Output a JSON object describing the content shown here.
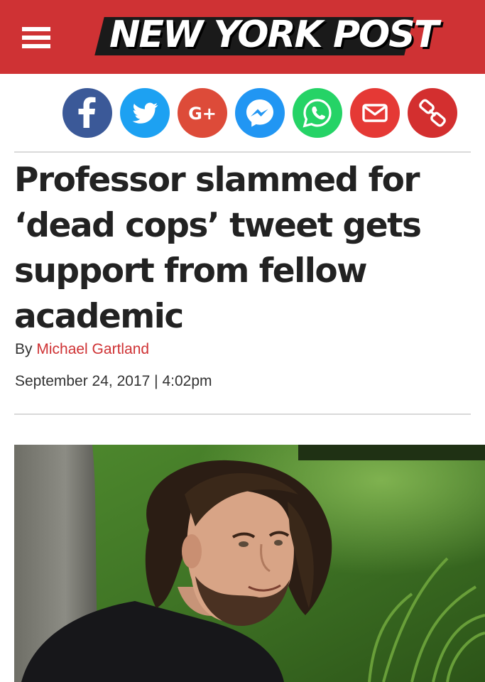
{
  "header": {
    "logo_text": "NEW YORK POST",
    "menu_icon": "hamburger-menu-icon",
    "bg_color": "#cf3234"
  },
  "share": [
    {
      "name": "facebook",
      "icon": "facebook-icon",
      "color": "#3b5998"
    },
    {
      "name": "twitter",
      "icon": "twitter-icon",
      "color": "#1da1f2"
    },
    {
      "name": "google-plus",
      "icon": "google-plus-icon",
      "color": "#dd4b39"
    },
    {
      "name": "messenger",
      "icon": "messenger-icon",
      "color": "#2196f3"
    },
    {
      "name": "whatsapp",
      "icon": "whatsapp-icon",
      "color": "#25d366"
    },
    {
      "name": "email",
      "icon": "email-icon",
      "color": "#e53935"
    },
    {
      "name": "copy-link",
      "icon": "link-icon",
      "color": "#d32f2f"
    }
  ],
  "share_labels": {
    "google_plus": "G+"
  },
  "article": {
    "headline": "Professor slammed for ‘dead cops’ tweet gets support from fellow academic",
    "byline_prefix": "By",
    "author": "Michael Gartland",
    "date": "September 24, 2017",
    "separator": "|",
    "time": "4:02pm"
  },
  "accent_color": "#cf3234"
}
